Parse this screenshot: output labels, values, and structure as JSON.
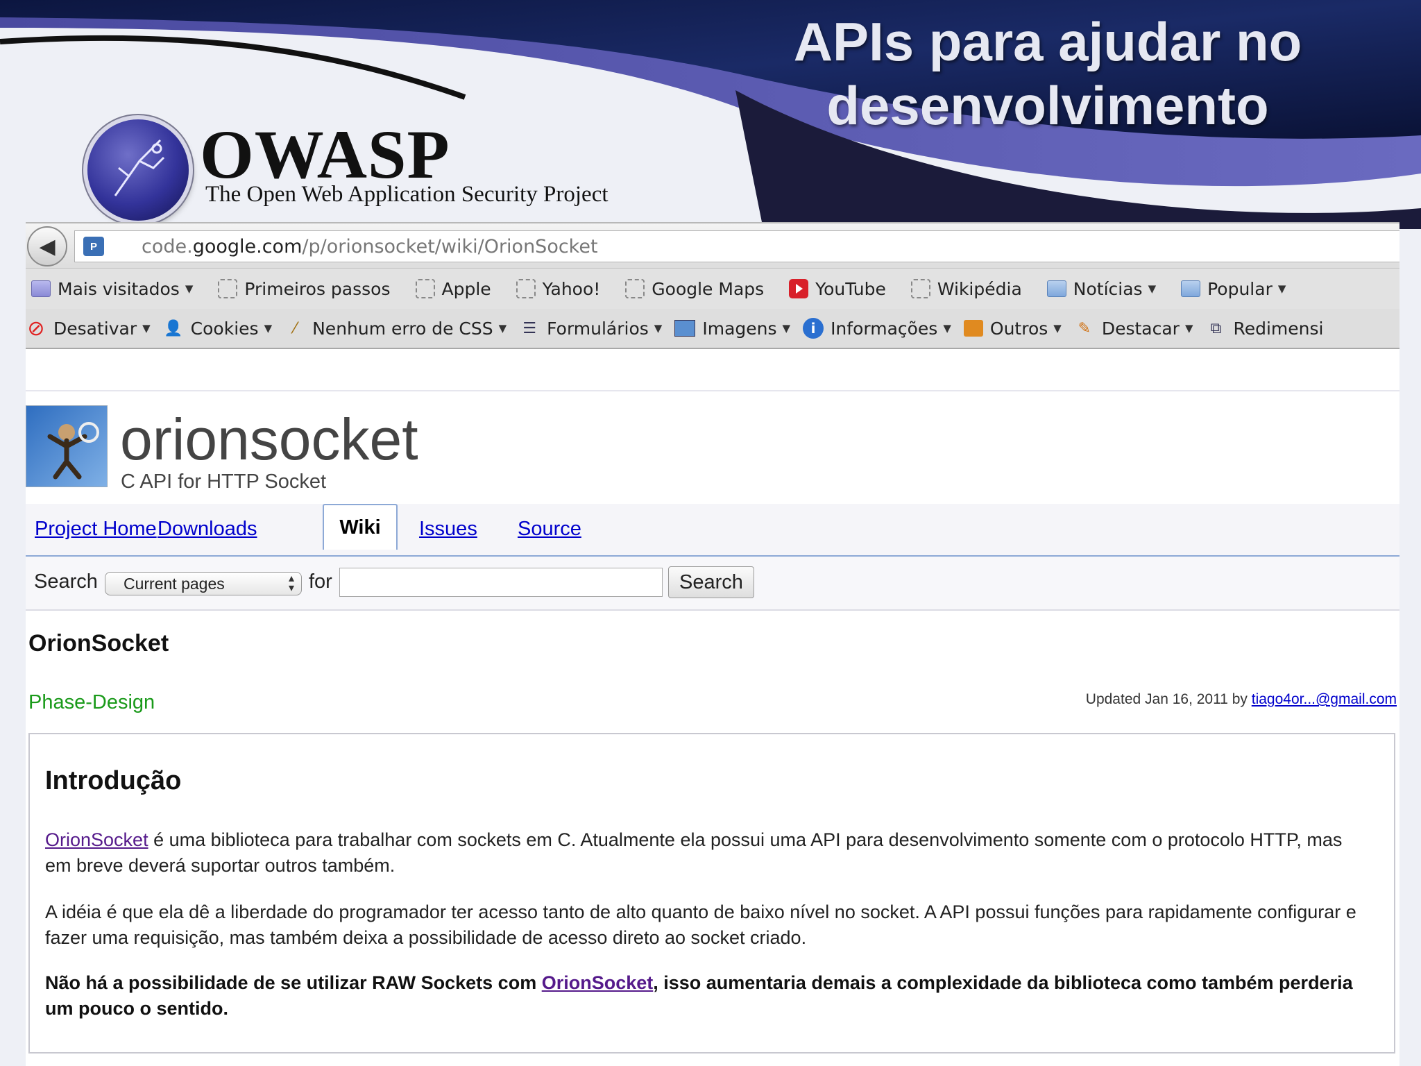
{
  "slide": {
    "title_line1": "APIs para ajudar no",
    "title_line2": "desenvolvimento",
    "org_name": "OWASP",
    "org_subtitle": "The Open Web Application Security Project"
  },
  "browser": {
    "url_prefix": "code.",
    "url_domain": "google.com",
    "url_path": "/p/orionsocket/wiki/OrionSocket",
    "bookmarks": [
      {
        "label": "Mais visitados",
        "icon": "smart-folder-icon",
        "dropdown": true
      },
      {
        "label": "Primeiros passos",
        "icon": "dashed-bookmark-icon",
        "dropdown": false
      },
      {
        "label": "Apple",
        "icon": "dashed-bookmark-icon",
        "dropdown": false
      },
      {
        "label": "Yahoo!",
        "icon": "dashed-bookmark-icon",
        "dropdown": false
      },
      {
        "label": "Google Maps",
        "icon": "dashed-bookmark-icon",
        "dropdown": false
      },
      {
        "label": "YouTube",
        "icon": "youtube-icon",
        "dropdown": false
      },
      {
        "label": "Wikipédia",
        "icon": "dashed-bookmark-icon",
        "dropdown": false
      },
      {
        "label": "Notícias",
        "icon": "folder-icon",
        "dropdown": true
      },
      {
        "label": "Popular",
        "icon": "folder-icon",
        "dropdown": true
      }
    ],
    "devtools": [
      {
        "label": "Desativar",
        "icon": "disable-icon"
      },
      {
        "label": "Cookies",
        "icon": "person-icon"
      },
      {
        "label": "Nenhum erro de CSS",
        "icon": "wand-icon"
      },
      {
        "label": "Formulários",
        "icon": "form-icon"
      },
      {
        "label": "Imagens",
        "icon": "image-icon"
      },
      {
        "label": "Informações",
        "icon": "info-icon"
      },
      {
        "label": "Outros",
        "icon": "other-icon"
      },
      {
        "label": "Destacar",
        "icon": "pencil-icon"
      },
      {
        "label": "Redimensi",
        "icon": "resize-icon"
      }
    ]
  },
  "project": {
    "name": "orionsocket",
    "summary": "C API for HTTP Socket",
    "tabs": {
      "project_home": "Project Home",
      "downloads": "Downloads",
      "wiki": "Wiki",
      "issues": "Issues",
      "source": "Source"
    },
    "search": {
      "label": "Search",
      "scope": "Current pages",
      "for_label": "for",
      "query": "",
      "button": "Search"
    },
    "wiki": {
      "title": "OrionSocket",
      "label": "Phase-Design",
      "updated_text": "Updated Jan 16, 2011 by ",
      "updated_author": "tiago4or...@gmail.com",
      "heading": "Introdução",
      "p1_link": "OrionSocket",
      "p1_text": " é uma biblioteca para trabalhar com sockets em C. Atualmente ela possui uma API para desenvolvimento somente com o protocolo HTTP, mas em breve deverá suportar outros também.",
      "p2_text": "A idéia é que ela dê a liberdade do programador ter acesso tanto de alto quanto de baixo nível no socket. A API possui funções para rapidamente configurar e fazer uma requisição, mas também deixa a possibilidade de acesso direto ao socket criado.",
      "p3_pre": "Não há a possibilidade de se utilizar RAW Sockets com ",
      "p3_link": "OrionSocket",
      "p3_post": ", isso aumentaria demais a complexidade da biblioteca como também perderia um pouco o sentido."
    }
  }
}
